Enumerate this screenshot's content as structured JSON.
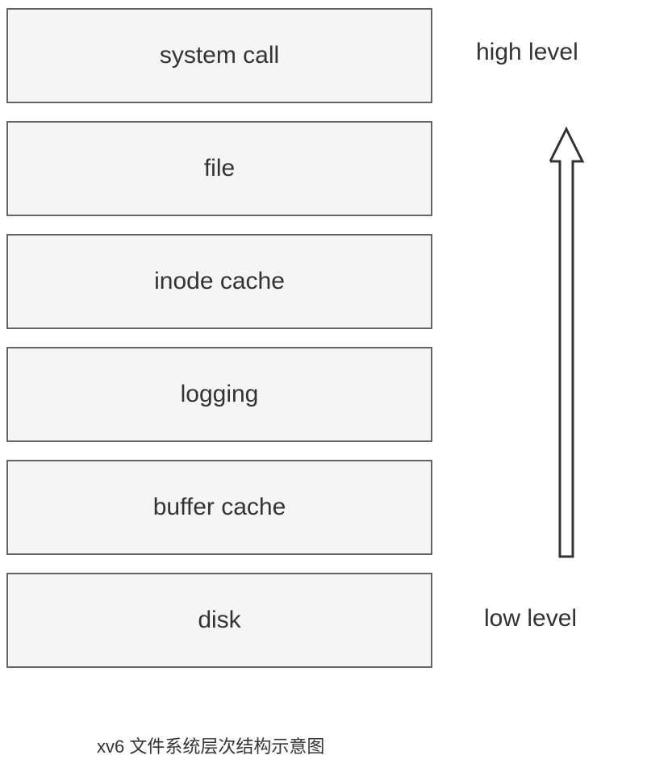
{
  "layers": {
    "0": {
      "label": "system call"
    },
    "1": {
      "label": "file"
    },
    "2": {
      "label": "inode cache"
    },
    "3": {
      "label": "logging"
    },
    "4": {
      "label": "buffer cache"
    },
    "5": {
      "label": "disk"
    }
  },
  "labels": {
    "high": "high level",
    "low": "low level"
  },
  "caption": "xv6 文件系统层次结构示意图"
}
